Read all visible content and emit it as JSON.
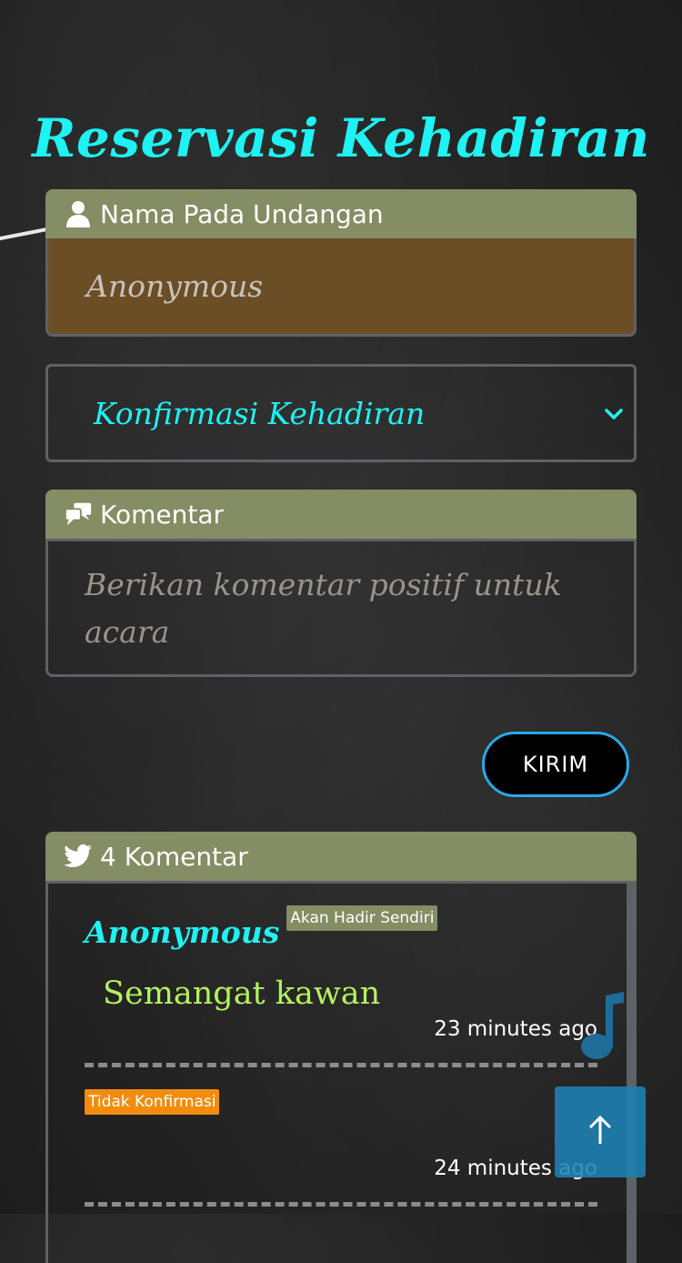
{
  "title": "Reservasi Kehadiran",
  "name_field": {
    "label": "Nama Pada Undangan",
    "value": "Anonymous",
    "icon": "user-icon"
  },
  "attendance_select": {
    "selected": "Konfirmasi Kehadiran",
    "icon": "chevron-down-icon"
  },
  "comment_field": {
    "label": "Komentar",
    "placeholder": "Berikan komentar positif untuk acara",
    "icon": "chat-bubbles-icon"
  },
  "submit_label": "KIRIM",
  "comments": {
    "header": "4 Komentar",
    "icon": "twitter-icon",
    "entries": [
      {
        "name": "Anonymous",
        "status": "Akan Hadir Sendiri",
        "message": "Semangat kawan",
        "time": "23 minutes ago"
      },
      {
        "name": "",
        "status": "Tidak Konfirmasi",
        "message": "",
        "time": "24 minutes ago"
      }
    ]
  },
  "colors": {
    "accent": "#1ff2f2",
    "header_bar": "#848d63",
    "name_field_bg": "#6b4e26",
    "message_text": "#b4f25e",
    "button_border": "#27a9e8",
    "badge_orange": "#f28c0f",
    "back_to_top_bg": "#1e82b4"
  }
}
